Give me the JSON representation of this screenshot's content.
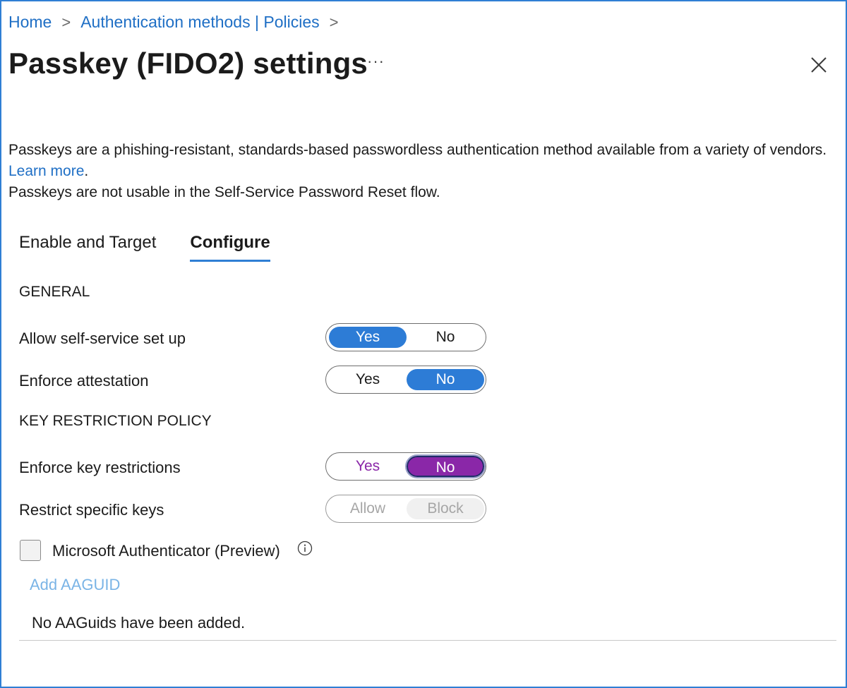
{
  "breadcrumb": {
    "items": [
      "Home",
      "Authentication methods | Policies"
    ],
    "separator": ">"
  },
  "header": {
    "title": "Passkey (FIDO2) settings",
    "more_label": "···"
  },
  "description": {
    "line1": "Passkeys are a phishing-resistant, standards-based passwordless authentication method available from a variety of vendors.",
    "learn_more": "Learn more",
    "period": ".",
    "line2": "Passkeys are not usable in the Self-Service Password Reset flow."
  },
  "tabs": [
    {
      "label": "Enable and Target",
      "active": false
    },
    {
      "label": "Configure",
      "active": true
    }
  ],
  "general": {
    "heading": "GENERAL",
    "allow_self_service": {
      "label": "Allow self-service set up",
      "yes": "Yes",
      "no": "No",
      "selected": "Yes"
    },
    "enforce_attestation": {
      "label": "Enforce attestation",
      "yes": "Yes",
      "no": "No",
      "selected": "No"
    }
  },
  "key_restriction": {
    "heading": "KEY RESTRICTION POLICY",
    "enforce_key_restrictions": {
      "label": "Enforce key restrictions",
      "yes": "Yes",
      "no": "No",
      "selected": "No"
    },
    "restrict_specific_keys": {
      "label": "Restrict specific keys",
      "allow": "Allow",
      "block": "Block",
      "selected": "Block",
      "disabled": true
    }
  },
  "microsoft_authenticator": {
    "label": "Microsoft Authenticator (Preview)",
    "checked": false
  },
  "add_aaguid": "Add AAGUID",
  "empty_message": "No AAGuids have been added.",
  "colors": {
    "accent": "#2d7cd6",
    "link": "#1f6fc5",
    "focus_purple": "#8a27a8",
    "border": "#2f7fd4"
  }
}
